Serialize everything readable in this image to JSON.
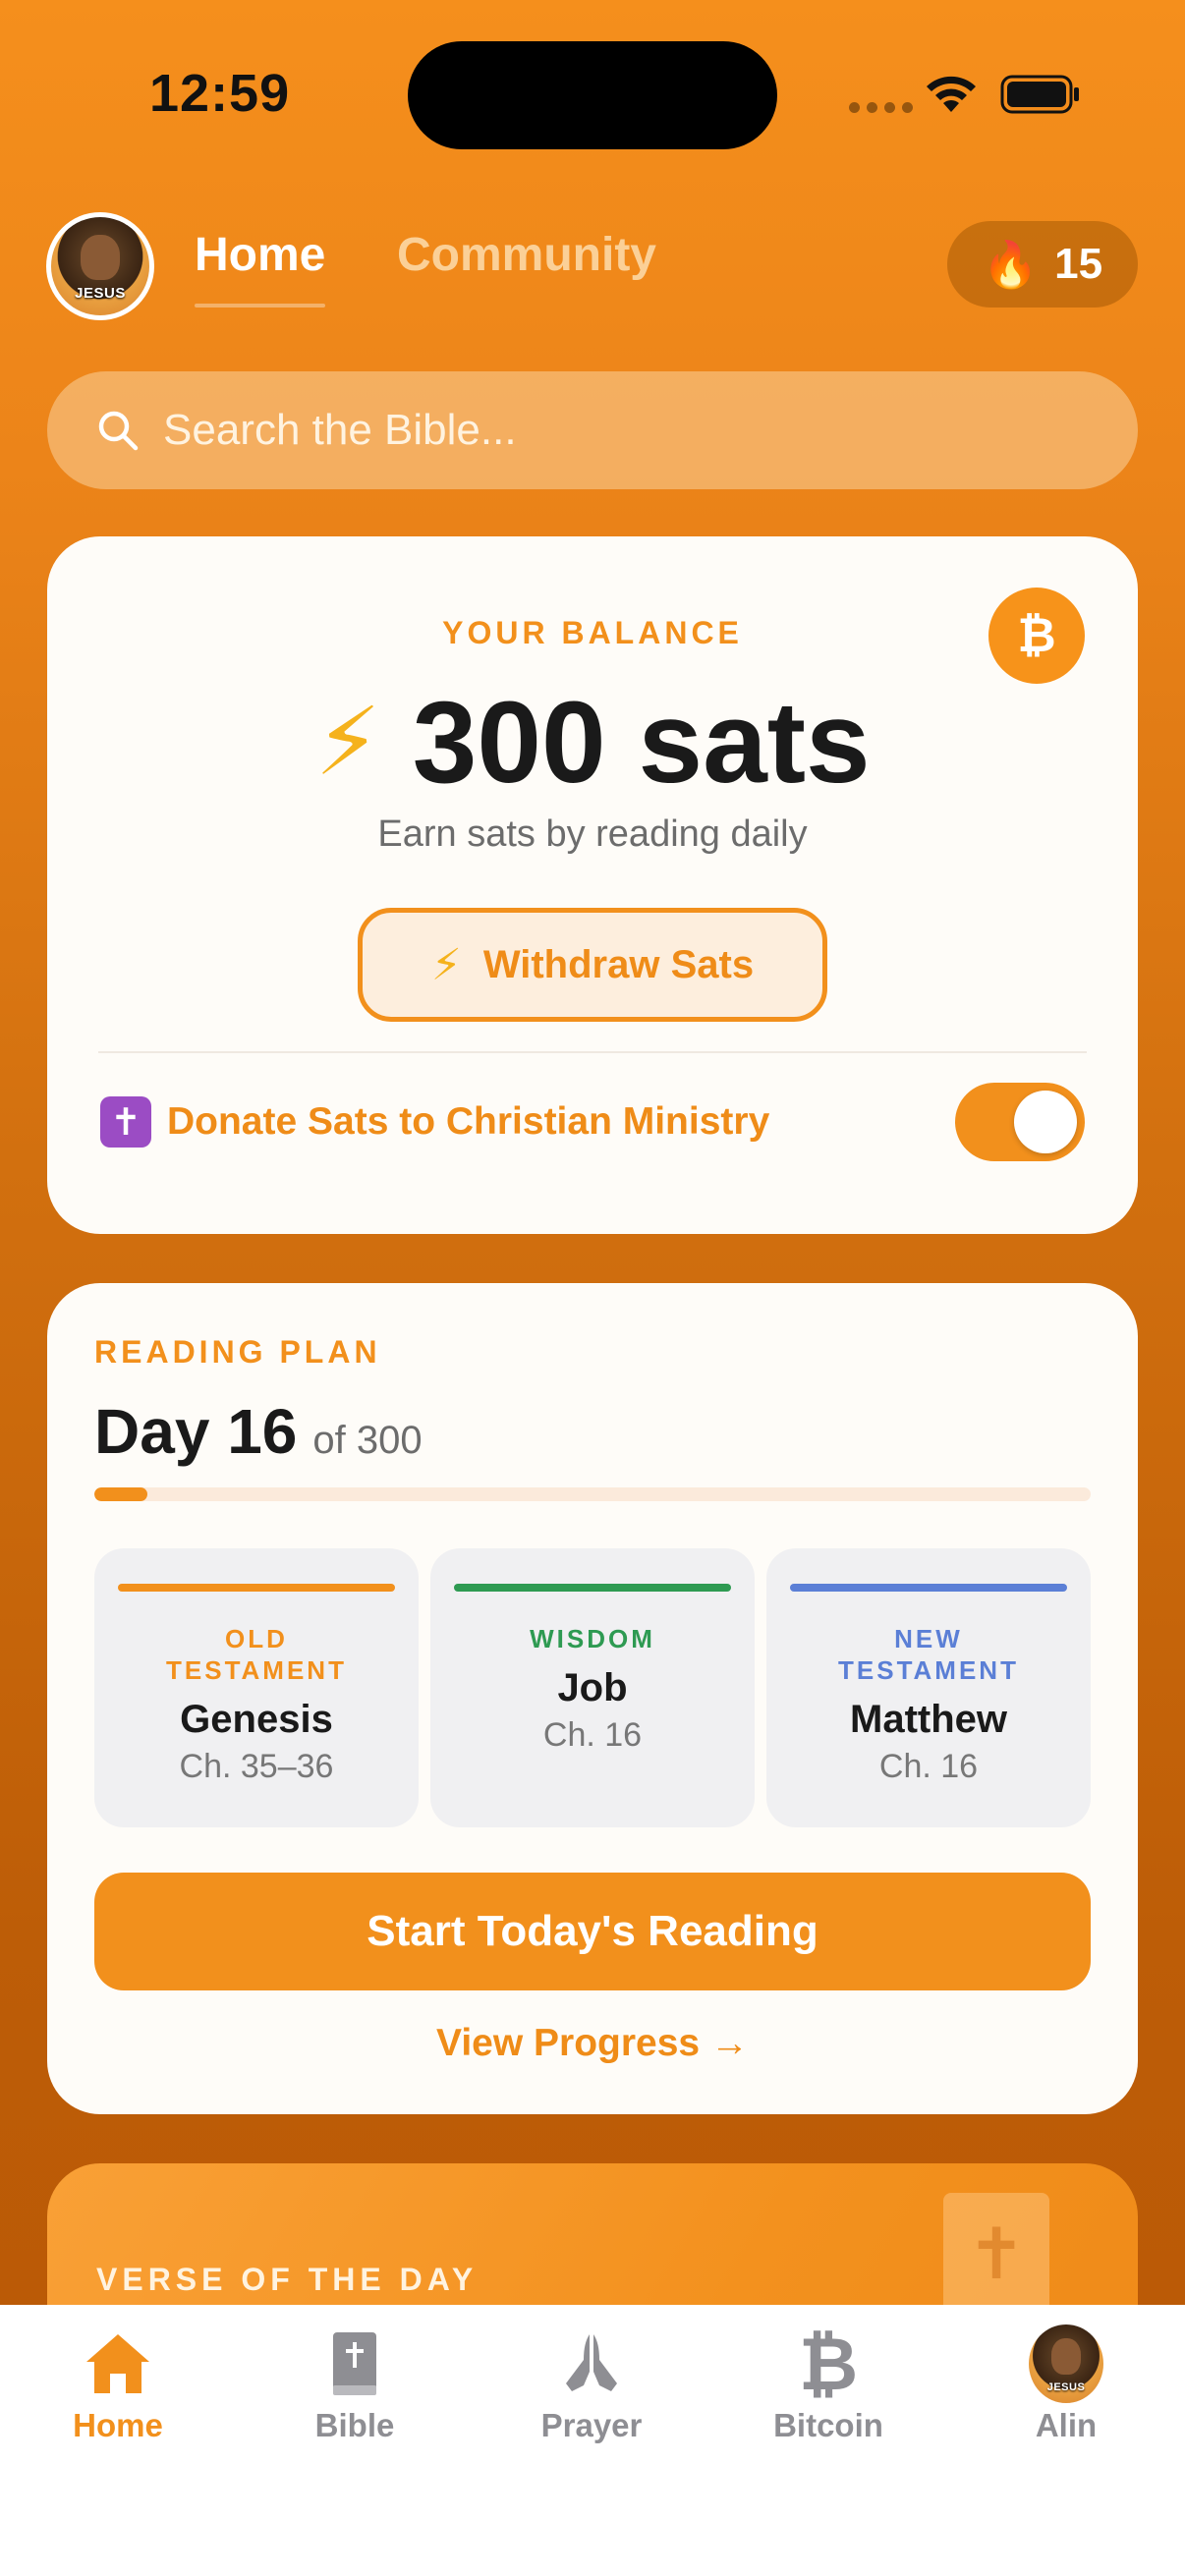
{
  "status_bar": {
    "time": "12:59"
  },
  "header": {
    "tabs": [
      {
        "label": "Home",
        "active": true
      },
      {
        "label": "Community",
        "active": false
      }
    ],
    "avatar_badge": "JESUS",
    "streak": {
      "icon": "flame-icon",
      "emoji": "🔥",
      "count": "15"
    }
  },
  "search": {
    "placeholder": "Search the Bible..."
  },
  "balance": {
    "label": "YOUR BALANCE",
    "amount": "300 sats",
    "subtitle": "Earn sats by reading daily",
    "btc_symbol": "₿",
    "withdraw_label": "Withdraw Sats",
    "donate_icon": "✝",
    "donate_label": "Donate Sats to Christian Ministry",
    "donate_enabled": true
  },
  "reading_plan": {
    "label": "READING PLAN",
    "day": "Day 16",
    "of_total": "of 300",
    "progress_fraction": 0.053,
    "tracks": [
      {
        "label": "OLD TESTAMENT",
        "book": "Genesis",
        "chapters": "Ch. 35–36",
        "color": "#f2901c"
      },
      {
        "label": "WISDOM",
        "book": "Job",
        "chapters": "Ch. 16",
        "color": "#2e9a52"
      },
      {
        "label": "NEW TESTAMENT",
        "book": "Matthew",
        "chapters": "Ch. 16",
        "color": "#5b7fd6"
      }
    ],
    "start_button": "Start Today's Reading",
    "view_progress": "View Progress →"
  },
  "verse": {
    "label": "VERSE OF THE DAY",
    "icon": "✝"
  },
  "tab_bar": {
    "items": [
      {
        "label": "Home",
        "icon": "home-icon",
        "active": true
      },
      {
        "label": "Bible",
        "icon": "bible-icon",
        "active": false
      },
      {
        "label": "Prayer",
        "icon": "praying-hands-icon",
        "active": false
      },
      {
        "label": "Bitcoin",
        "icon": "bitcoin-icon",
        "active": false
      },
      {
        "label": "Alin",
        "icon": "profile-avatar",
        "active": false
      }
    ]
  },
  "colors": {
    "accent": "#f2901c",
    "wisdom": "#2e9a52",
    "new_testament": "#5b7fd6"
  }
}
